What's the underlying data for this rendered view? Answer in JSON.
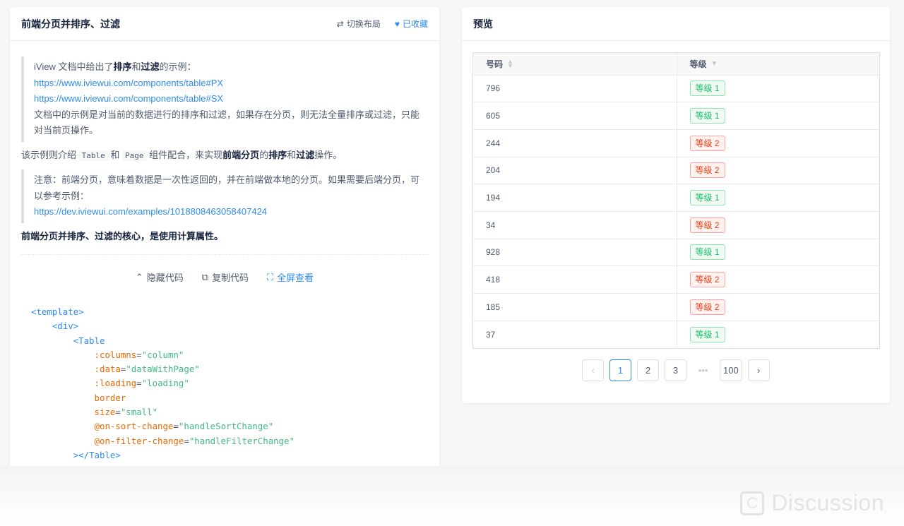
{
  "left": {
    "title": "前端分页并排序、过滤",
    "switch_layout": "切换布局",
    "favorited": "已收藏",
    "quote1": {
      "prefix": "iView 文档中给出了",
      "b1": "排序",
      "mid": "和",
      "b2": "过滤",
      "suffix": "的示例：",
      "link1": "https://www.iviewui.com/components/table#PX",
      "link2": "https://www.iviewui.com/components/table#SX",
      "line": "文档中的示例是对当前的数据进行的排序和过滤，如果存在分页，则无法全量排序或过滤，只能对当前页操作。"
    },
    "para1": {
      "t1": "该示例则介绍",
      "code1": "Table",
      "t2": "和",
      "code2": "Page",
      "t3": "组件配合，来实现",
      "b1": "前端分页",
      "t4": "的",
      "b2": "排序",
      "t5": "和",
      "b3": "过滤",
      "t6": "操作。"
    },
    "quote2": {
      "line": "注意：前端分页，意味着数据是一次性返回的，并在前端做本地的分页。如果需要后端分页，可以参考示例：",
      "link": "https://dev.iviewui.com/examples/1018808463058407424"
    },
    "summary": "前端分页并排序、过滤的核心，是使用计算属性。",
    "actions": {
      "hide_code": "隐藏代码",
      "copy_code": "复制代码",
      "fullscreen": "全屏查看"
    },
    "code": {
      "l1": "<template>",
      "l2": "<div>",
      "l3": "<Table",
      "a1": ":columns",
      "v1": "\"column\"",
      "a2": ":data",
      "v2": "\"dataWithPage\"",
      "a3": ":loading",
      "v3": "\"loading\"",
      "a4": "border",
      "a5": "size",
      "v5": "\"small\"",
      "a6": "@on-sort-change",
      "v6": "\"handleSortChange\"",
      "a7": "@on-filter-change",
      "v7": "\"handleFilterChange\"",
      "l4": "></Table>",
      "eq": "="
    }
  },
  "right": {
    "title": "预览",
    "columns": [
      "号码",
      "等级"
    ],
    "rows": [
      {
        "num": "796",
        "level": "等级 1",
        "color": "green"
      },
      {
        "num": "605",
        "level": "等级 1",
        "color": "green"
      },
      {
        "num": "244",
        "level": "等级 2",
        "color": "red"
      },
      {
        "num": "204",
        "level": "等级 2",
        "color": "red"
      },
      {
        "num": "194",
        "level": "等级 1",
        "color": "green"
      },
      {
        "num": "34",
        "level": "等级 2",
        "color": "red"
      },
      {
        "num": "928",
        "level": "等级 1",
        "color": "green"
      },
      {
        "num": "418",
        "level": "等级 2",
        "color": "red"
      },
      {
        "num": "185",
        "level": "等级 2",
        "color": "red"
      },
      {
        "num": "37",
        "level": "等级 1",
        "color": "green"
      }
    ],
    "pager": {
      "prev": "‹",
      "next": "›",
      "pages": [
        "1",
        "2",
        "3"
      ],
      "ellipsis": "•••",
      "last": "100",
      "current": "1"
    }
  },
  "watermark": "Discussion",
  "colors": {
    "accent": "#2d8cf0",
    "green": "#19be6b",
    "red": "#ed4014"
  }
}
